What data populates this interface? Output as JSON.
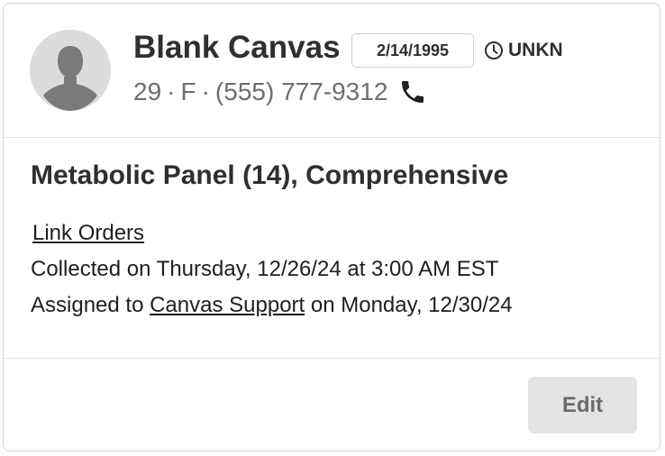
{
  "patient": {
    "name": "Blank Canvas",
    "dob": "2/14/1995",
    "status": "UNKN",
    "age": "29",
    "sex": "F",
    "separator": "·",
    "phone": "(555) 777-9312"
  },
  "order": {
    "title": "Metabolic Panel (14), Comprehensive",
    "link_orders_label": "Link Orders",
    "collected_text": "Collected on Thursday, 12/26/24 at 3:00 AM EST",
    "assigned_prefix": "Assigned to",
    "assignee": "Canvas Support",
    "assigned_suffix": "on Monday, 12/30/24"
  },
  "actions": {
    "edit_label": "Edit"
  },
  "icons": {
    "avatar": "person-silhouette-icon",
    "status": "clock-icon",
    "phone": "phone-icon"
  },
  "colors": {
    "avatar_bg": "#dcdcdc",
    "avatar_figure": "#7a7a7a",
    "edit_button_bg": "#e3e4e6",
    "muted_text": "#6e6e6e"
  }
}
